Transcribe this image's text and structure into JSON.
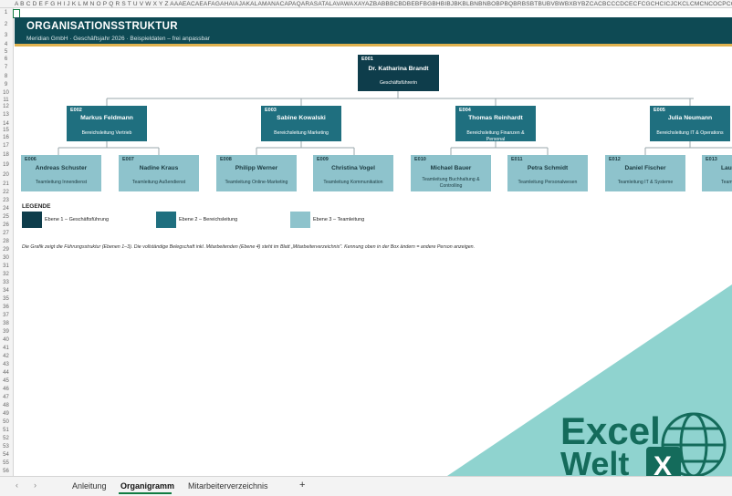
{
  "column_headers": "A B C D E F G H I J K L M N O P Q R S T U V W X Y Z AAAEACAEAFAGAHAIAJAKALAMANACAPAQARASATALAVAWAXAYAZBABBBCBDBEBFBGBHBIBJBKBLBNBNBOBPBQBRBSBTBUBVBWBXBYBZCACBCCCDCECFCGCHCICJCKCLCMCNCOCPCQCR",
  "rows": [
    "1",
    "2",
    "3",
    "4",
    "5",
    "6",
    "7",
    "8",
    "9",
    "10",
    "11",
    "12",
    "13",
    "14",
    "15",
    "16",
    "17",
    "18",
    "19",
    "20",
    "21",
    "22",
    "23",
    "24",
    "25",
    "26",
    "27",
    "28",
    "29",
    "30",
    "31",
    "32",
    "33",
    "34",
    "35",
    "36",
    "37",
    "38",
    "39",
    "40",
    "41",
    "42",
    "43",
    "44",
    "45",
    "46",
    "47",
    "48",
    "49",
    "50",
    "51",
    "52",
    "53",
    "54",
    "55",
    "56",
    "57"
  ],
  "header": {
    "title": "ORGANISATIONSSTRUKTUR",
    "subtitle": "Meridian GmbH  ·  Geschäftsjahr 2026  ·  Beispieldaten – frei anpassbar"
  },
  "level1": {
    "id": "E001",
    "name": "Dr. Katharina Brandt",
    "role": "Geschäftsführerin"
  },
  "level2": [
    {
      "id": "E002",
      "name": "Markus Feldmann",
      "role": "Bereichsleitung Vertrieb"
    },
    {
      "id": "E003",
      "name": "Sabine Kowalski",
      "role": "Bereichsleitung Marketing"
    },
    {
      "id": "E004",
      "name": "Thomas Reinhardt",
      "role": "Bereichsleitung Finanzen & Personal"
    },
    {
      "id": "E005",
      "name": "Julia Neumann",
      "role": "Bereichsleitung IT & Operations"
    }
  ],
  "level3": [
    {
      "id": "E006",
      "name": "Andreas Schuster",
      "role": "Teamleitung Innendienst"
    },
    {
      "id": "E007",
      "name": "Nadine Kraus",
      "role": "Teamleitung Außendienst"
    },
    {
      "id": "E008",
      "name": "Philipp Werner",
      "role": "Teamleitung Online-Marketing"
    },
    {
      "id": "E009",
      "name": "Christina Vogel",
      "role": "Teamleitung Kommunikation"
    },
    {
      "id": "E010",
      "name": "Michael Bauer",
      "role": "Teamleitung Buchhaltung & Controlling"
    },
    {
      "id": "E011",
      "name": "Petra Schmidt",
      "role": "Teamleitung Personalwesen"
    },
    {
      "id": "E012",
      "name": "Daniel Fischer",
      "role": "Teamleitung IT & Systeme"
    },
    {
      "id": "E013",
      "name": "Lau",
      "role": "Teamleitun"
    }
  ],
  "legend": {
    "title": "LEGENDE",
    "items": [
      {
        "label": "Ebene 1 – Geschäftsführung",
        "color": "#0e3d4b"
      },
      {
        "label": "Ebene 2 – Bereichsleitung",
        "color": "#1f6f7f"
      },
      {
        "label": "Ebene 3 – Teamleitung",
        "color": "#8ec3cc"
      }
    ]
  },
  "note": "Die Grafik zeigt die Führungsstruktur (Ebenen 1–3). Die vollständige Belegschaft inkl. Mitarbeitenden (Ebene 4) steht im Blatt „Mitarbeiterverzeichnis\". Kennung oben in der Box ändern = andere Person anzeigen.",
  "tabs": {
    "items": [
      "Anleitung",
      "Organigramm",
      "Mitarbeiterverzeichnis"
    ],
    "active": "Organigramm",
    "add": "+"
  },
  "watermark": {
    "line1": "Excel",
    "line2": "Welt",
    "icon": "excel-x-globe-icon"
  }
}
